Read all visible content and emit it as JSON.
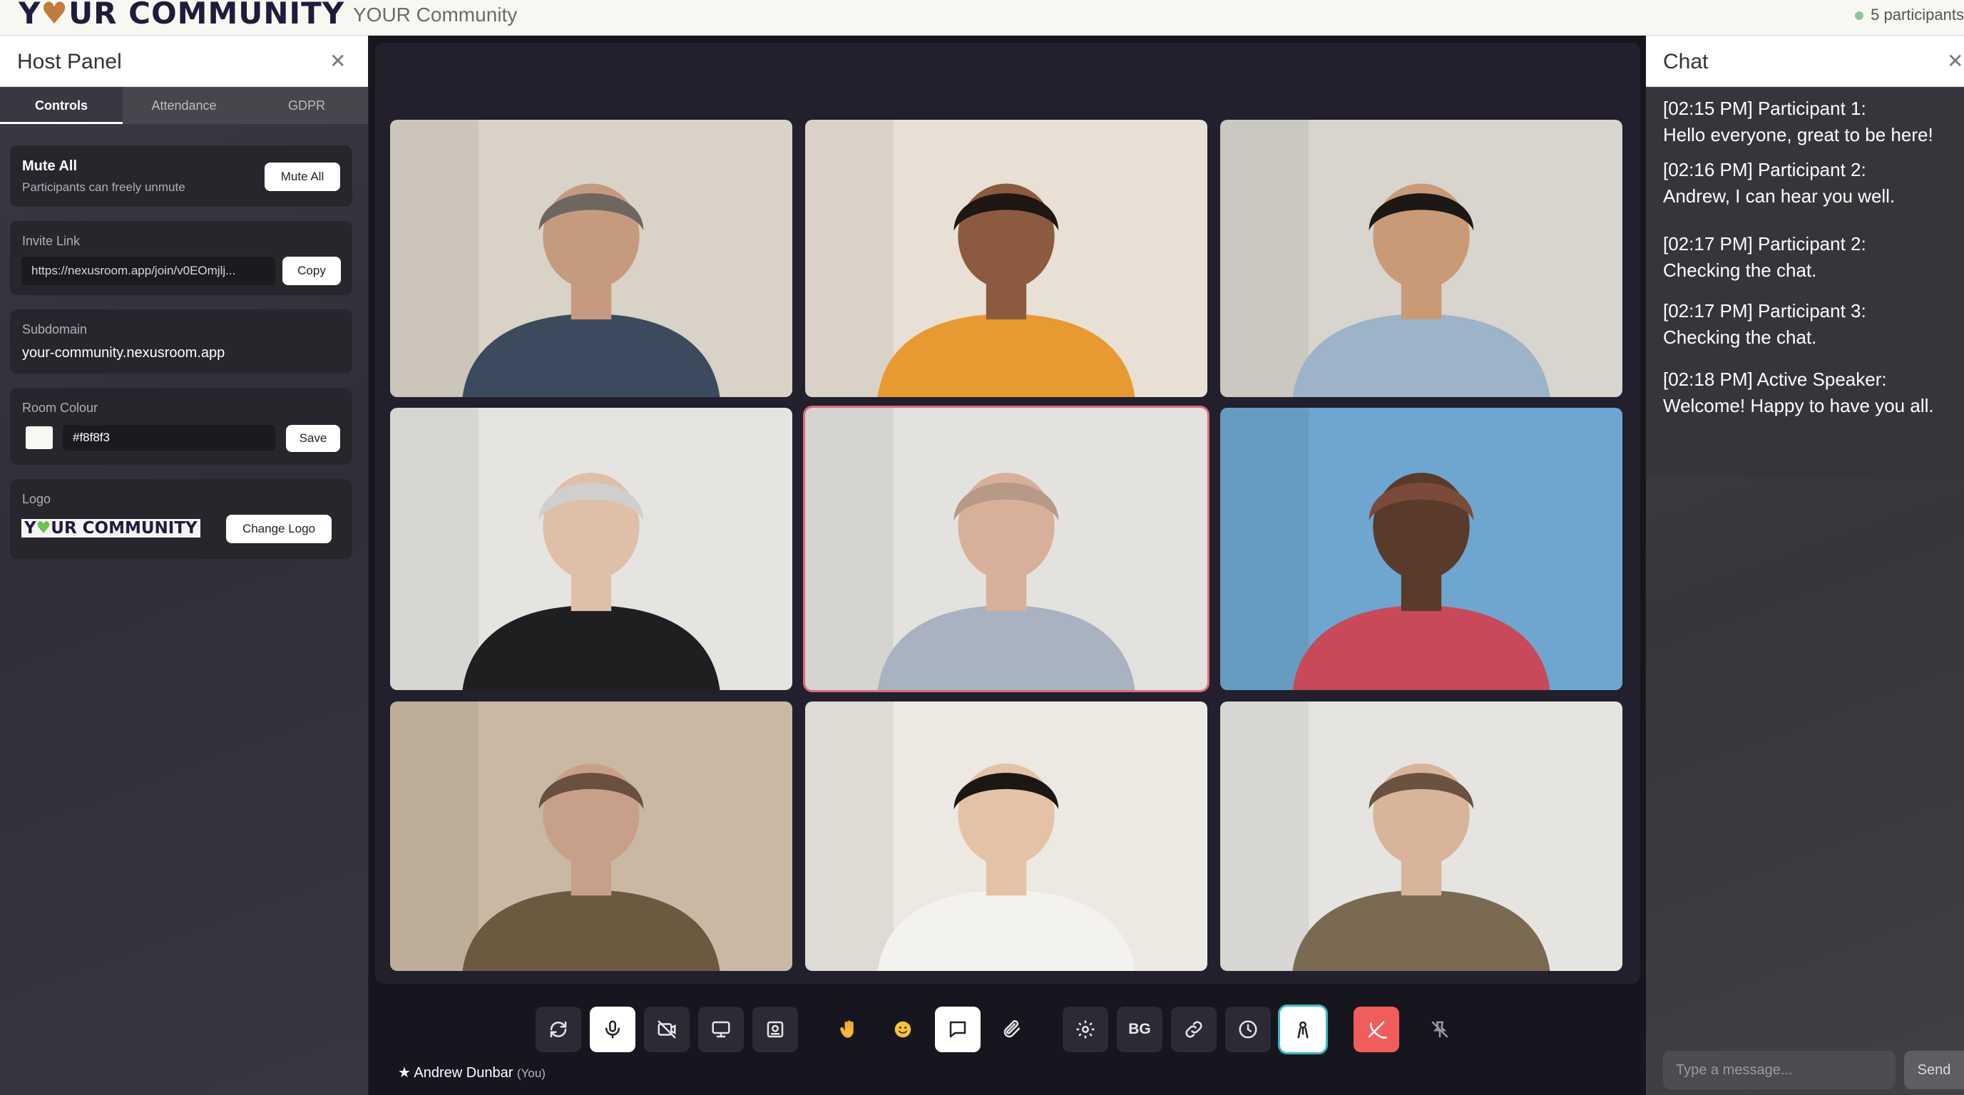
{
  "topbar": {
    "logo_text_1": "Y",
    "logo_heart": "♥",
    "logo_text_2": "UR COMMUNITY",
    "app_title": "YOUR Community",
    "participants": "5 participants"
  },
  "host_panel": {
    "title": "Host Panel",
    "close_icon": "close-icon",
    "tabs": [
      {
        "label": "Controls",
        "active": true
      },
      {
        "label": "Attendance",
        "active": false
      },
      {
        "label": "GDPR",
        "active": false
      }
    ],
    "mute_all": {
      "title": "Mute All",
      "subtitle": "Participants can freely unmute",
      "button": "Mute All"
    },
    "invite": {
      "label": "Invite Link",
      "value": "https://nexusroom.app/join/v0EOmjlj...",
      "button": "Copy"
    },
    "subdomain": {
      "label": "Subdomain",
      "value": "your-community.nexusroom.app"
    },
    "room_colour": {
      "label": "Room Colour",
      "value": "#f8f8f3",
      "swatch": "#f8f8f3",
      "button": "Save"
    },
    "logo": {
      "label": "Logo",
      "mini_1": "Y",
      "mini_heart": "♥",
      "mini_2": "UR COMMUNITY",
      "button": "Change Logo"
    }
  },
  "stage": {
    "local_user": "Andrew Dunbar",
    "you_suffix": "(You)",
    "tiles": [
      {
        "skin": "#c69a7e",
        "hair": "#6e6660",
        "shirt": "#3c4a5e",
        "bg": "#d9d2c6"
      },
      {
        "skin": "#8c5a3e",
        "hair": "#1e1714",
        "shirt": "#e89a32",
        "bg": "#e8e0d4"
      },
      {
        "skin": "#c99a76",
        "hair": "#1c1816",
        "shirt": "#9cb3c8",
        "bg": "#d8d4ce"
      },
      {
        "skin": "#e0bfa8",
        "hair": "#cfcfcf",
        "shirt": "#1f1f22",
        "bg": "#e6e4e0"
      },
      {
        "skin": "#d8b09a",
        "hair": "#b89886",
        "shirt": "#a8b2c0",
        "bg": "#e4e2de"
      },
      {
        "skin": "#5a3a2a",
        "hair": "#7a4a3a",
        "shirt": "#c84a5a",
        "bg": "#6ea6cf"
      },
      {
        "skin": "#c8a08a",
        "hair": "#6a5040",
        "shirt": "#6b5a3f",
        "bg": "#c9b9a4"
      },
      {
        "skin": "#e4c2a6",
        "hair": "#1c1614",
        "shirt": "#f4f2ee",
        "bg": "#ece8e2"
      },
      {
        "skin": "#d8b49a",
        "hair": "#6a5240",
        "shirt": "#7a6a52",
        "bg": "#e6e4e0"
      }
    ],
    "toolbar": {
      "bg_label": "BG"
    }
  },
  "chat": {
    "title": "Chat",
    "messages": [
      {
        "line1": "[02:15 PM] Participant 1:",
        "line2": "Hello everyone, great to be here!"
      },
      {
        "line1": "[02:16 PM] Participant 2:",
        "line2": "Andrew, I can hear you well."
      },
      {
        "line1": "[02:17 PM] Participant 2:",
        "line2": "Checking the chat."
      },
      {
        "line1": "[02:17 PM] Participant 3:",
        "line2": "Checking the chat."
      },
      {
        "line1": "[02:18 PM] Active Speaker:",
        "line2": "Welcome! Happy to have you all."
      }
    ],
    "input_placeholder": "Type a message...",
    "send_label": "Send"
  },
  "colors": {
    "accent_active_speaker": "#d86e7a",
    "leave_button": "#f15d5d",
    "spotlight_ring": "#3ab7c2",
    "online_dot": "#8bc79a"
  }
}
